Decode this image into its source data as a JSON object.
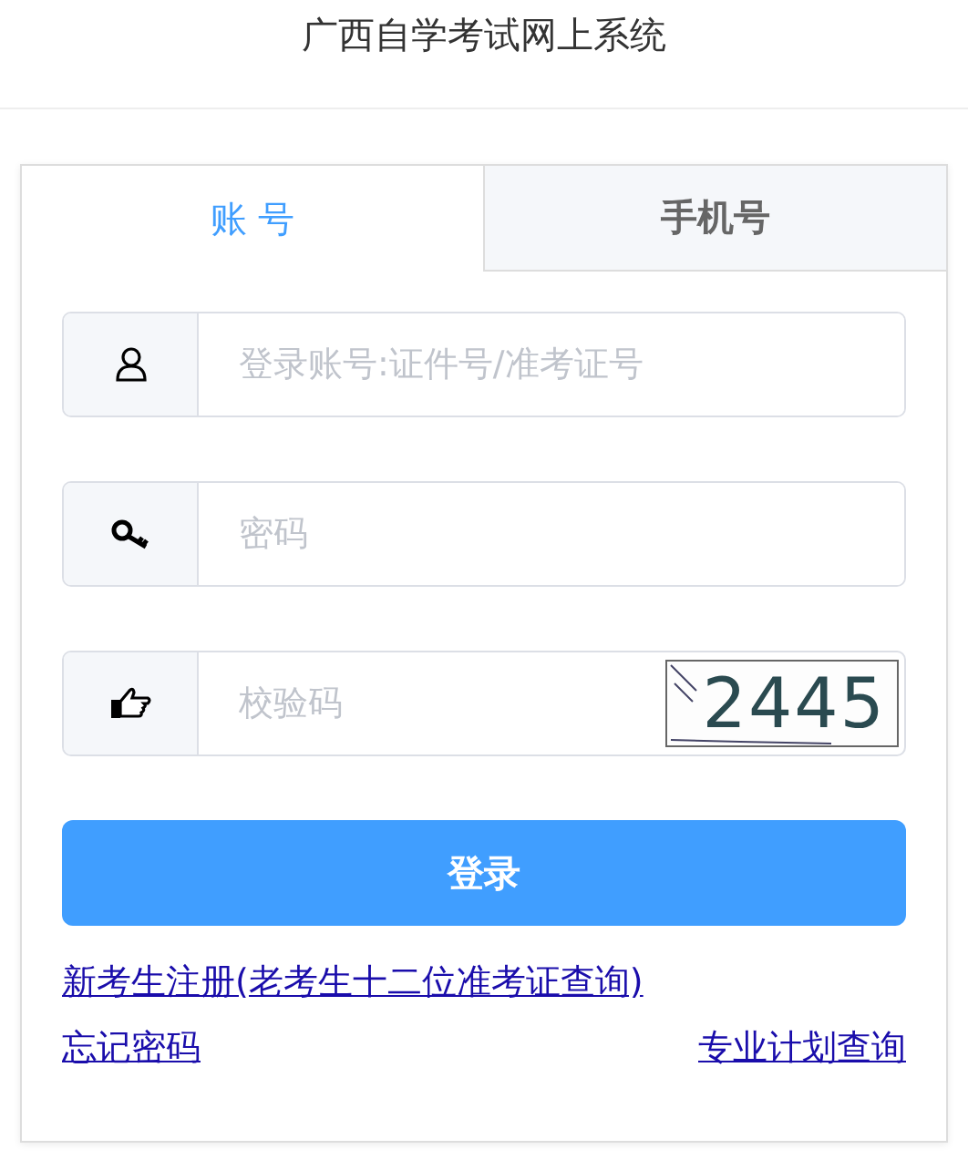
{
  "header": {
    "title": "广西自学考试网上系统"
  },
  "tabs": [
    {
      "label": "账 号",
      "selected": true
    },
    {
      "label": "手机号",
      "selected": false
    }
  ],
  "fields": [
    {
      "kind": "account",
      "placeholder": "登录账号:证件号/准考证号"
    },
    {
      "kind": "password",
      "placeholder": "密码"
    },
    {
      "kind": "captcha",
      "placeholder": "校验码",
      "captcha": "2445"
    }
  ],
  "login_button": "登录",
  "links": [
    {
      "label": "新考生注册(老考生十二位准考证查询)"
    },
    {
      "label": "忘记密码"
    },
    {
      "label": "专业计划查询"
    }
  ]
}
